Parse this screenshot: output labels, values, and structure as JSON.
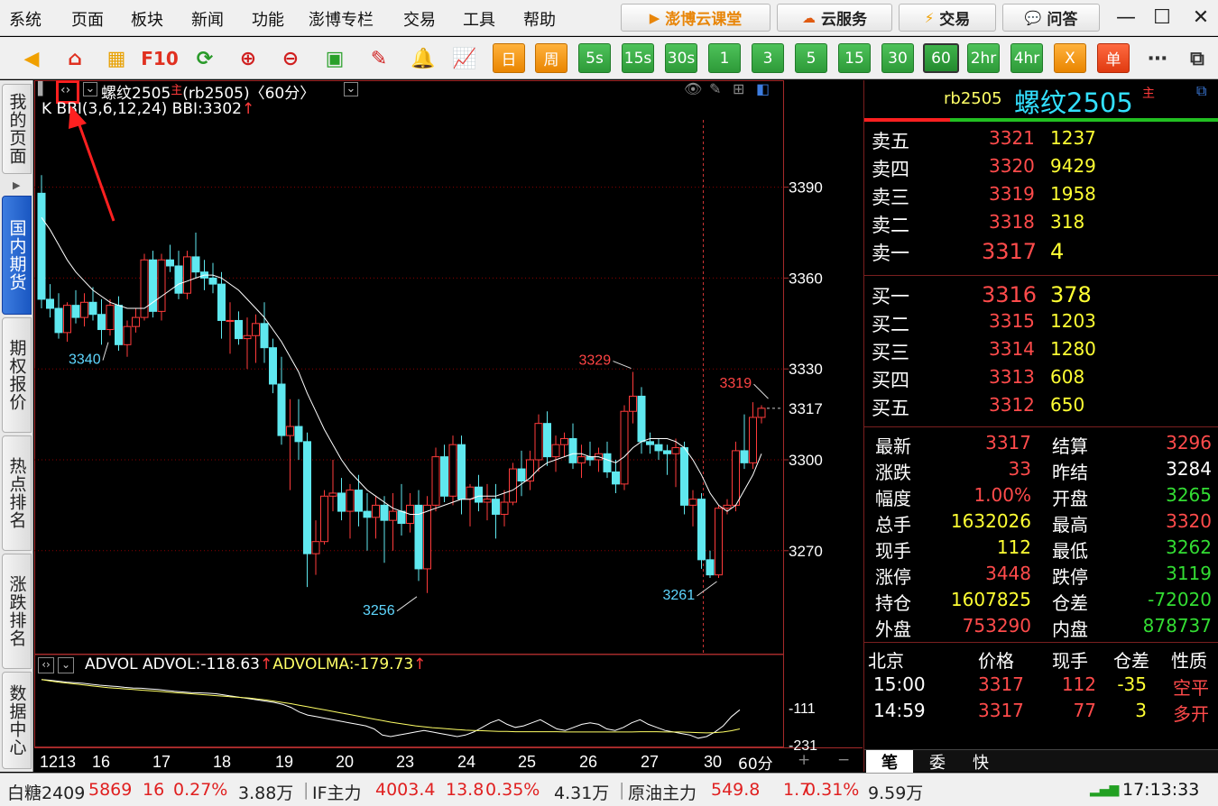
{
  "menu": [
    "系统",
    "页面",
    "板块",
    "新闻",
    "功能",
    "澎博专栏",
    "交易",
    "工具",
    "帮助"
  ],
  "top_buttons": {
    "classroom": "澎博云课堂",
    "cloud": "云服务",
    "trade": "交易",
    "qa": "问答"
  },
  "toolbar": {
    "f10": "F10",
    "day": "日",
    "week": "周"
  },
  "periods": [
    "5s",
    "15s",
    "30s",
    "1",
    "3",
    "5",
    "15",
    "30",
    "60",
    "2hr",
    "4hr",
    "X",
    "单"
  ],
  "sidebar": [
    "我的页面",
    "国内期货",
    "期权报价",
    "热点排名",
    "涨跌排名",
    "数据中心"
  ],
  "chart": {
    "title": "螺纹2505",
    "title_tag": "主",
    "code_period": "(rb2505)〈60分〉",
    "indicator": "K BBI(3,6,12,24) BBI:3302",
    "sub_indicator": "ADVOL ADVOL:-118.63",
    "sub_ma": "ADVOLMA:-179.73",
    "period_label": "60分"
  },
  "chart_data": {
    "type": "candlestick",
    "price_axis": {
      "ticks": [
        3390,
        3360,
        3330,
        3300,
        3270
      ],
      "current_label": "3317",
      "range": [
        3236,
        3414
      ]
    },
    "sub_axis": {
      "ticks": [
        "-111",
        "-231"
      ]
    },
    "x_ticks": [
      "1213",
      "16",
      "17",
      "18",
      "19",
      "20",
      "23",
      "24",
      "25",
      "26",
      "27",
      "30"
    ],
    "annotations": [
      {
        "label": "3340",
        "value": 3340,
        "color": "#5fd7ff"
      },
      {
        "label": "3329",
        "value": 3329,
        "color": "#ff4444"
      },
      {
        "label": "3319",
        "value": 3319,
        "color": "#ff4444"
      },
      {
        "label": "3256",
        "value": 3256,
        "color": "#5fd7ff"
      },
      {
        "label": "3261",
        "value": 3261,
        "color": "#5fd7ff"
      }
    ],
    "candles": [
      [
        3388,
        3394,
        3350,
        3353
      ],
      [
        3353,
        3358,
        3347,
        3350
      ],
      [
        3350,
        3355,
        3340,
        3342
      ],
      [
        3342,
        3352,
        3339,
        3351
      ],
      [
        3351,
        3356,
        3345,
        3347
      ],
      [
        3347,
        3355,
        3344,
        3352
      ],
      [
        3352,
        3357,
        3346,
        3348
      ],
      [
        3348,
        3353,
        3338,
        3343
      ],
      [
        3343,
        3353,
        3341,
        3351
      ],
      [
        3351,
        3354,
        3336,
        3338
      ],
      [
        3338,
        3346,
        3334,
        3344
      ],
      [
        3344,
        3350,
        3342,
        3347
      ],
      [
        3347,
        3368,
        3346,
        3366
      ],
      [
        3366,
        3369,
        3347,
        3349
      ],
      [
        3349,
        3368,
        3346,
        3366
      ],
      [
        3366,
        3371,
        3362,
        3364
      ],
      [
        3364,
        3369,
        3353,
        3355
      ],
      [
        3355,
        3369,
        3353,
        3367
      ],
      [
        3367,
        3375,
        3360,
        3362
      ],
      [
        3362,
        3366,
        3356,
        3360
      ],
      [
        3360,
        3365,
        3355,
        3358
      ],
      [
        3358,
        3362,
        3340,
        3346
      ],
      [
        3346,
        3352,
        3335,
        3346
      ],
      [
        3346,
        3349,
        3338,
        3340
      ],
      [
        3340,
        3347,
        3330,
        3341
      ],
      [
        3341,
        3348,
        3332,
        3345
      ],
      [
        3345,
        3352,
        3332,
        3337
      ],
      [
        3337,
        3340,
        3322,
        3325
      ],
      [
        3325,
        3334,
        3305,
        3308
      ],
      [
        3308,
        3320,
        3290,
        3311
      ],
      [
        3311,
        3320,
        3300,
        3306
      ],
      [
        3306,
        3309,
        3258,
        3269
      ],
      [
        3269,
        3280,
        3262,
        3273
      ],
      [
        3273,
        3290,
        3272,
        3288
      ],
      [
        3288,
        3300,
        3283,
        3289
      ],
      [
        3289,
        3294,
        3280,
        3283
      ],
      [
        3283,
        3292,
        3274,
        3290
      ],
      [
        3290,
        3295,
        3278,
        3283
      ],
      [
        3283,
        3289,
        3270,
        3281
      ],
      [
        3281,
        3288,
        3274,
        3285
      ],
      [
        3285,
        3288,
        3266,
        3280
      ],
      [
        3280,
        3289,
        3270,
        3283
      ],
      [
        3283,
        3292,
        3275,
        3279
      ],
      [
        3279,
        3289,
        3276,
        3285
      ],
      [
        3285,
        3290,
        3260,
        3264
      ],
      [
        3264,
        3288,
        3256,
        3285
      ],
      [
        3285,
        3304,
        3283,
        3301
      ],
      [
        3301,
        3305,
        3286,
        3288
      ],
      [
        3288,
        3308,
        3285,
        3305
      ],
      [
        3305,
        3308,
        3282,
        3287
      ],
      [
        3287,
        3292,
        3278,
        3291
      ],
      [
        3291,
        3295,
        3283,
        3286
      ],
      [
        3286,
        3292,
        3280,
        3287
      ],
      [
        3287,
        3292,
        3274,
        3282
      ],
      [
        3282,
        3290,
        3278,
        3286
      ],
      [
        3286,
        3299,
        3285,
        3297
      ],
      [
        3297,
        3303,
        3288,
        3293
      ],
      [
        3293,
        3303,
        3290,
        3300
      ],
      [
        3300,
        3315,
        3296,
        3312
      ],
      [
        3312,
        3316,
        3298,
        3301
      ],
      [
        3301,
        3308,
        3296,
        3305
      ],
      [
        3305,
        3309,
        3301,
        3307
      ],
      [
        3307,
        3312,
        3297,
        3299
      ],
      [
        3299,
        3305,
        3294,
        3301
      ],
      [
        3301,
        3306,
        3298,
        3300
      ],
      [
        3300,
        3304,
        3296,
        3302
      ],
      [
        3302,
        3306,
        3294,
        3296
      ],
      [
        3296,
        3300,
        3289,
        3292
      ],
      [
        3292,
        3318,
        3290,
        3316
      ],
      [
        3316,
        3329,
        3312,
        3321
      ],
      [
        3321,
        3324,
        3302,
        3306
      ],
      [
        3306,
        3309,
        3302,
        3305
      ],
      [
        3305,
        3307,
        3300,
        3303
      ],
      [
        3303,
        3305,
        3295,
        3302
      ],
      [
        3302,
        3307,
        3291,
        3304
      ],
      [
        3304,
        3306,
        3282,
        3285
      ],
      [
        3285,
        3290,
        3278,
        3287
      ],
      [
        3287,
        3289,
        3264,
        3267
      ],
      [
        3267,
        3270,
        3261,
        3262
      ],
      [
        3262,
        3285,
        3261,
        3284
      ],
      [
        3284,
        3287,
        3282,
        3285
      ],
      [
        3285,
        3306,
        3283,
        3303
      ],
      [
        3303,
        3315,
        3297,
        3299
      ],
      [
        3299,
        3319,
        3297,
        3314
      ],
      [
        3314,
        3318,
        3312,
        3317
      ]
    ],
    "bbi": [
      3380,
      3376,
      3371,
      3366,
      3362,
      3359,
      3356,
      3354,
      3352,
      3351,
      3350,
      3350,
      3350,
      3352,
      3354,
      3356,
      3358,
      3359,
      3360,
      3361,
      3361,
      3360,
      3358,
      3356,
      3353,
      3350,
      3347,
      3343,
      3339,
      3334,
      3329,
      3322,
      3316,
      3310,
      3305,
      3300,
      3296,
      3293,
      3290,
      3288,
      3286,
      3284,
      3283,
      3282,
      3282,
      3283,
      3284,
      3285,
      3286,
      3287,
      3287,
      3288,
      3288,
      3288,
      3289,
      3290,
      3292,
      3294,
      3297,
      3299,
      3300,
      3301,
      3302,
      3302,
      3301,
      3301,
      3300,
      3299,
      3301,
      3304,
      3306,
      3307,
      3307,
      3307,
      3306,
      3304,
      3300,
      3295,
      3289,
      3285,
      3283,
      3285,
      3290,
      3295,
      3302
    ],
    "advol": [
      -20,
      -22,
      -25,
      -28,
      -30,
      -32,
      -35,
      -38,
      -40,
      -42,
      -45,
      -47,
      -48,
      -50,
      -52,
      -55,
      -58,
      -60,
      -62,
      -63,
      -64,
      -66,
      -70,
      -74,
      -78,
      -82,
      -86,
      -90,
      -94,
      -100,
      -110,
      -125,
      -135,
      -140,
      -145,
      -150,
      -155,
      -160,
      -165,
      -170,
      -180,
      -200,
      -205,
      -200,
      -195,
      -190,
      -185,
      -190,
      -195,
      -200,
      -205,
      -200,
      -190,
      -175,
      -160,
      -150,
      -165,
      -175,
      -170,
      -160,
      -150,
      -165,
      -180,
      -185,
      -175,
      -165,
      -160,
      -165,
      -180,
      -185,
      -175,
      -160,
      -150,
      -165,
      -175,
      -185,
      -190,
      -195,
      -200,
      -210,
      -205,
      -190,
      -170,
      -140,
      -118
    ],
    "advolma": [
      -20,
      -24,
      -28,
      -31,
      -34,
      -37,
      -40,
      -43,
      -46,
      -48,
      -50,
      -52,
      -54,
      -56,
      -58,
      -60,
      -62,
      -64,
      -66,
      -68,
      -70,
      -72,
      -74,
      -76,
      -78,
      -80,
      -83,
      -86,
      -90,
      -94,
      -98,
      -103,
      -108,
      -113,
      -118,
      -123,
      -128,
      -133,
      -138,
      -143,
      -148,
      -153,
      -158,
      -162,
      -166,
      -170,
      -173,
      -176,
      -178,
      -180,
      -182,
      -184,
      -185,
      -186,
      -187,
      -188,
      -188,
      -189,
      -189,
      -189,
      -189,
      -189,
      -189,
      -190,
      -190,
      -190,
      -190,
      -190,
      -190,
      -190,
      -190,
      -190,
      -189,
      -189,
      -189,
      -190,
      -190,
      -190,
      -191,
      -192,
      -193,
      -192,
      -190,
      -186,
      -180
    ]
  },
  "quote": {
    "code": "rb2505",
    "name": "螺纹2505",
    "tag": "主",
    "asks": [
      {
        "label": "卖五",
        "price": "3321",
        "vol": "1237"
      },
      {
        "label": "卖四",
        "price": "3320",
        "vol": "9429"
      },
      {
        "label": "卖三",
        "price": "3319",
        "vol": "1958"
      },
      {
        "label": "卖二",
        "price": "3318",
        "vol": "318"
      },
      {
        "label": "卖一",
        "price": "3317",
        "vol": "4"
      }
    ],
    "bids": [
      {
        "label": "买一",
        "price": "3316",
        "vol": "378"
      },
      {
        "label": "买二",
        "price": "3315",
        "vol": "1203"
      },
      {
        "label": "买三",
        "price": "3314",
        "vol": "1280"
      },
      {
        "label": "买四",
        "price": "3313",
        "vol": "608"
      },
      {
        "label": "买五",
        "price": "3312",
        "vol": "650"
      }
    ],
    "stats": [
      {
        "l1": "最新",
        "v1": "3317",
        "c1": "#ff4b4b",
        "l2": "结算",
        "v2": "3296",
        "c2": "#ff4b4b"
      },
      {
        "l1": "涨跌",
        "v1": "33",
        "c1": "#ff4b4b",
        "l2": "昨结",
        "v2": "3284",
        "c2": "#ffffff"
      },
      {
        "l1": "幅度",
        "v1": "1.00%",
        "c1": "#ff4b4b",
        "l2": "开盘",
        "v2": "3265",
        "c2": "#33dd33"
      },
      {
        "l1": "总手",
        "v1": "1632026",
        "c1": "#ffff33",
        "l2": "最高",
        "v2": "3320",
        "c2": "#ff4b4b"
      },
      {
        "l1": "现手",
        "v1": "112",
        "c1": "#ffff33",
        "l2": "最低",
        "v2": "3262",
        "c2": "#33dd33"
      },
      {
        "l1": "涨停",
        "v1": "3448",
        "c1": "#ff4b4b",
        "l2": "跌停",
        "v2": "3119",
        "c2": "#33dd33"
      },
      {
        "l1": "持仓",
        "v1": "1607825",
        "c1": "#ffff33",
        "l2": "仓差",
        "v2": "-72020",
        "c2": "#33dd33"
      },
      {
        "l1": "外盘",
        "v1": "753290",
        "c1": "#ff4b4b",
        "l2": "内盘",
        "v2": "878737",
        "c2": "#33dd33"
      }
    ],
    "ticks_header": [
      "北京",
      "价格",
      "现手",
      "仓差",
      "性质"
    ],
    "ticks": [
      {
        "time": "15:00",
        "price": "3317",
        "vol": "112",
        "oi": "-35",
        "type": "空平",
        "type_color": "#ff4b4b",
        "oi_color": "#ffff33"
      },
      {
        "time": "14:59",
        "price": "3317",
        "vol": "77",
        "oi": "3",
        "type": "多开",
        "type_color": "#ff4b4b",
        "oi_color": "#ffff33"
      }
    ],
    "tabs": [
      "笔",
      "委",
      "快"
    ]
  },
  "statusbar": {
    "items": [
      {
        "name": "白糖2409",
        "price": "5869",
        "chg": "16",
        "pct": "0.27%",
        "vol": "3.88万"
      },
      {
        "name": "IF主力",
        "price": "4003.4",
        "chg": "13.8",
        "pct": "0.35%",
        "vol": "4.31万"
      },
      {
        "name": "原油主力",
        "price": "549.8",
        "chg": "1.7",
        "pct": "0.31%",
        "vol": "9.59万"
      }
    ],
    "time": "17:13:33"
  },
  "colors": {
    "up": "#ff3b3b",
    "down": "#5fe8ef",
    "bbi": "#ffffff",
    "advolma": "#ffff66",
    "grid": "#8b0000",
    "axis": "#a52a2a"
  }
}
